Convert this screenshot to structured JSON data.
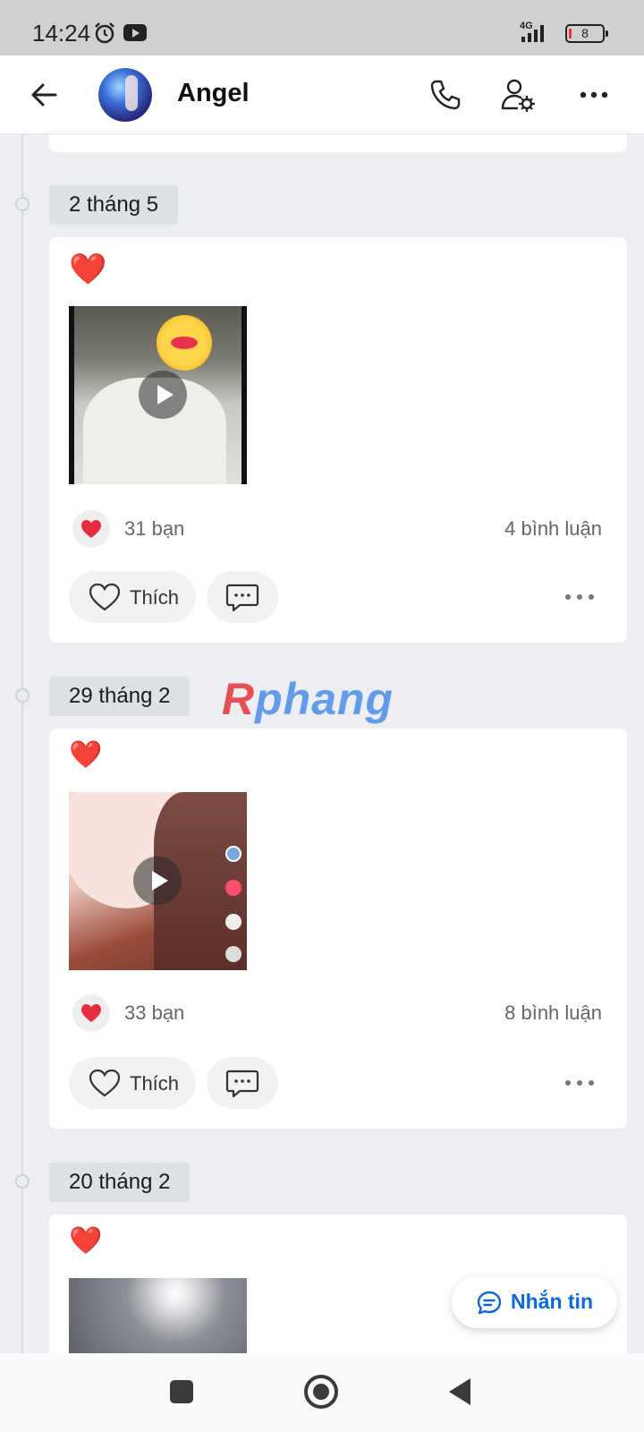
{
  "status_bar": {
    "time": "14:24",
    "network": "4G",
    "battery": "8"
  },
  "header": {
    "title": "Angel",
    "icons": [
      "back-arrow-icon",
      "phone-icon",
      "user-settings-icon",
      "more-icon"
    ]
  },
  "posts": [
    {
      "date": "2 tháng 5",
      "reaction_emoji": "❤️",
      "video_thumbnail": "video-thumbnail",
      "friends_label": "31 bạn",
      "comments_label": "4 bình luận",
      "like_label": "Thích"
    },
    {
      "date": "29 tháng 2",
      "reaction_emoji": "❤️",
      "video_thumbnail": "video-thumbnail",
      "friends_label": "33 bạn",
      "comments_label": "8 bình luận",
      "like_label": "Thích"
    },
    {
      "date": "20 tháng 2",
      "reaction_emoji": "❤️",
      "video_thumbnail": "video-thumbnail"
    }
  ],
  "watermark": {
    "r": "R",
    "rest": "phang"
  },
  "message_button": {
    "label": "Nhắn tin"
  },
  "colors": {
    "accent": "#0a68d8",
    "heart": "#e52d3c",
    "background": "#eceef1"
  }
}
